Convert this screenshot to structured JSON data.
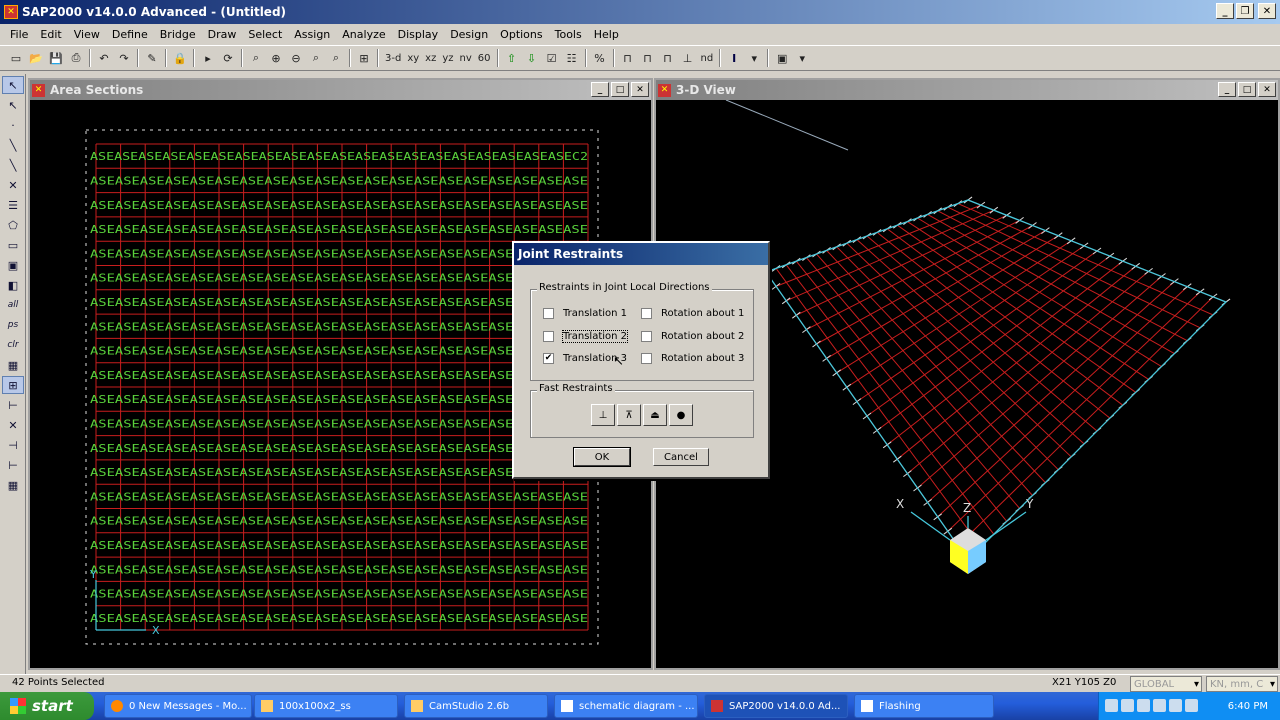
{
  "app": {
    "title": "SAP2000 v14.0.0 Advanced  - (Untitled)"
  },
  "menu": [
    "File",
    "Edit",
    "View",
    "Define",
    "Bridge",
    "Draw",
    "Select",
    "Assign",
    "Analyze",
    "Display",
    "Design",
    "Options",
    "Tools",
    "Help"
  ],
  "toolbar": {
    "view_labels": [
      "3-d",
      "xy",
      "xz",
      "yz",
      "nv",
      "60"
    ],
    "nd_label": "nd"
  },
  "left_tools": {
    "labels": [
      "all",
      "ps",
      "clr"
    ]
  },
  "area_window": {
    "title": "Area Sections",
    "cell_label": "ASE",
    "last_row_tail": "C2",
    "axis_label": "X",
    "y_axis_label": "Y"
  },
  "view3d_window": {
    "title": "3-D View",
    "axis_z": "Z",
    "axis_x": "X",
    "axis_y": "Y"
  },
  "dialog": {
    "title": "Joint Restraints",
    "group1_label": "Restraints in Joint Local Directions",
    "checkboxes": [
      {
        "label": "Translation  1",
        "checked": false
      },
      {
        "label": "Rotation about  1",
        "checked": false
      },
      {
        "label": "Translation  2",
        "checked": false
      },
      {
        "label": "Rotation about  2",
        "checked": false
      },
      {
        "label": "Translation  3",
        "checked": true
      },
      {
        "label": "Rotation about  3",
        "checked": false
      }
    ],
    "group2_label": "Fast Restraints",
    "ok_label": "OK",
    "cancel_label": "Cancel"
  },
  "status": {
    "left": "42 Points Selected",
    "coords": "X21  Y105  Z0",
    "coord_system": "GLOBAL",
    "units": "KN, mm, C"
  },
  "taskbar": {
    "start": "start",
    "tasks": [
      "0 New Messages - Mo...",
      "100x100x2_ss",
      "CamStudio 2.6b",
      "schematic diagram - ...",
      "SAP2000 v14.0.0 Ad...",
      "Flashing"
    ],
    "clock": "6:40 PM"
  },
  "colors": {
    "grid_red": "#c81e1e",
    "label_green": "#5ad23c",
    "frame_cyan": "#46c8dc"
  }
}
